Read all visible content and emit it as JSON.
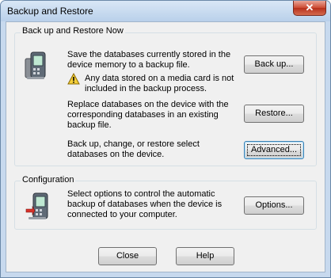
{
  "window": {
    "title": "Backup and Restore",
    "close_glyph": "✕"
  },
  "backup_group": {
    "label": "Back up and Restore Now",
    "backup_text": [
      "Save the databases currently stored in the",
      "device memory to a backup file."
    ],
    "warning_text": [
      "Any data stored on a media card is not",
      "included in the backup process."
    ],
    "restore_text": [
      "Replace databases on the device with the",
      "corresponding databases in an existing",
      "backup file."
    ],
    "advanced_text": [
      "Back up, change, or restore select",
      "databases on the device."
    ],
    "backup_button": "Back up...",
    "restore_button": "Restore...",
    "advanced_button": "Advanced..."
  },
  "config_group": {
    "label": "Configuration",
    "text": [
      "Select options to control the automatic",
      "backup of databases when the device is",
      "connected to your computer."
    ],
    "options_button": "Options..."
  },
  "footer": {
    "close_button": "Close",
    "help_button": "Help"
  },
  "icons": {
    "device": "handheld-device-icon",
    "warning": "warning-icon",
    "sync": "handheld-sync-icon"
  }
}
